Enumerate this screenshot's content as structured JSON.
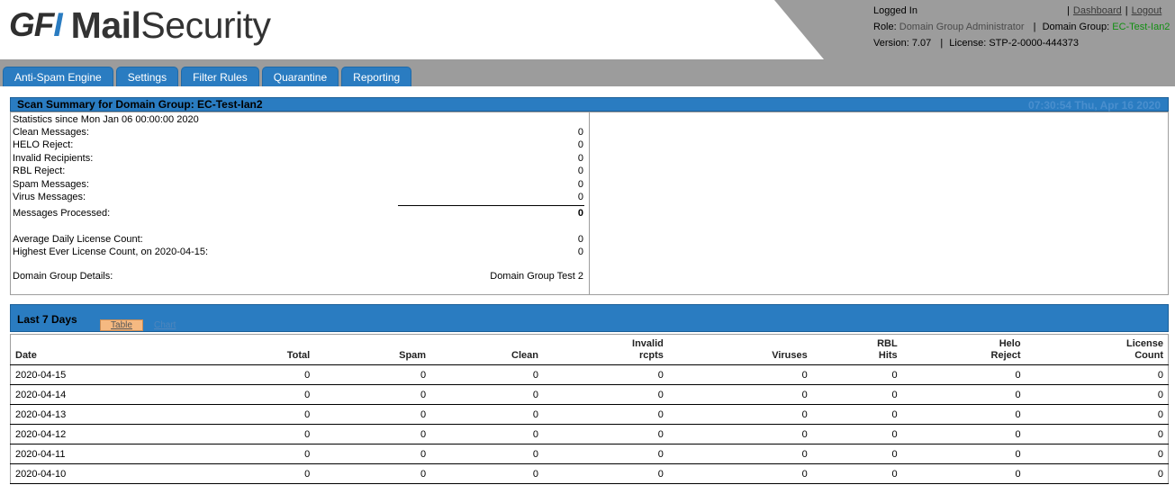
{
  "brand": {
    "logo_gfi_1": "GF",
    "logo_gfi_slash": "I",
    "logo_mail": "Mail",
    "logo_security": "Security",
    "accent": "#2a7cc1"
  },
  "user": {
    "logged_in_label": "Logged In",
    "dashboard_link": "Dashboard",
    "logout_link": "Logout",
    "role_label": "Role:",
    "role_value": "Domain Group Administrator",
    "domain_group_label": "Domain Group:",
    "domain_group_value": "EC-Test-Ian2",
    "version_label": "Version:",
    "version_value": "7.07",
    "license_label": "License:",
    "license_value": "STP-2-0000-444373"
  },
  "tabs": [
    {
      "label": "Anti-Spam Engine"
    },
    {
      "label": "Settings"
    },
    {
      "label": "Filter Rules"
    },
    {
      "label": "Quarantine"
    },
    {
      "label": "Reporting"
    }
  ],
  "summary": {
    "title": "Scan Summary for Domain Group: EC-Test-Ian2",
    "timestamp": "07:30:54 Thu, Apr 16 2020",
    "since": "Statistics since Mon Jan 06 00:00:00 2020",
    "rows": [
      {
        "label": "Clean Messages:",
        "value": "0"
      },
      {
        "label": "HELO Reject:",
        "value": "0"
      },
      {
        "label": "Invalid Recipients:",
        "value": "0"
      },
      {
        "label": "RBL Reject:",
        "value": "0"
      },
      {
        "label": "Spam Messages:",
        "value": "0"
      },
      {
        "label": "Virus Messages:",
        "value": "0"
      }
    ],
    "processed_label": "Messages Processed:",
    "processed_value": "0",
    "avg_license_label": "Average Daily License Count:",
    "avg_license_value": "0",
    "highest_license_label": "Highest Ever License Count, on 2020-04-15:",
    "highest_license_value": "0",
    "details_label": "Domain Group Details:",
    "details_value": "Domain Group Test 2"
  },
  "last7": {
    "title": "Last 7 Days",
    "table_button": "Table",
    "chart_button": "Chart",
    "columns": [
      {
        "l1": "",
        "l2": "Date"
      },
      {
        "l1": "",
        "l2": "Total"
      },
      {
        "l1": "",
        "l2": "Spam"
      },
      {
        "l1": "",
        "l2": "Clean"
      },
      {
        "l1": "Invalid",
        "l2": "rcpts"
      },
      {
        "l1": "",
        "l2": "Viruses"
      },
      {
        "l1": "RBL",
        "l2": "Hits"
      },
      {
        "l1": "Helo",
        "l2": "Reject"
      },
      {
        "l1": "License",
        "l2": "Count"
      }
    ],
    "rows": [
      [
        "2020-04-15",
        "0",
        "0",
        "0",
        "0",
        "0",
        "0",
        "0",
        "0"
      ],
      [
        "2020-04-14",
        "0",
        "0",
        "0",
        "0",
        "0",
        "0",
        "0",
        "0"
      ],
      [
        "2020-04-13",
        "0",
        "0",
        "0",
        "0",
        "0",
        "0",
        "0",
        "0"
      ],
      [
        "2020-04-12",
        "0",
        "0",
        "0",
        "0",
        "0",
        "0",
        "0",
        "0"
      ],
      [
        "2020-04-11",
        "0",
        "0",
        "0",
        "0",
        "0",
        "0",
        "0",
        "0"
      ],
      [
        "2020-04-10",
        "0",
        "0",
        "0",
        "0",
        "0",
        "0",
        "0",
        "0"
      ]
    ]
  }
}
